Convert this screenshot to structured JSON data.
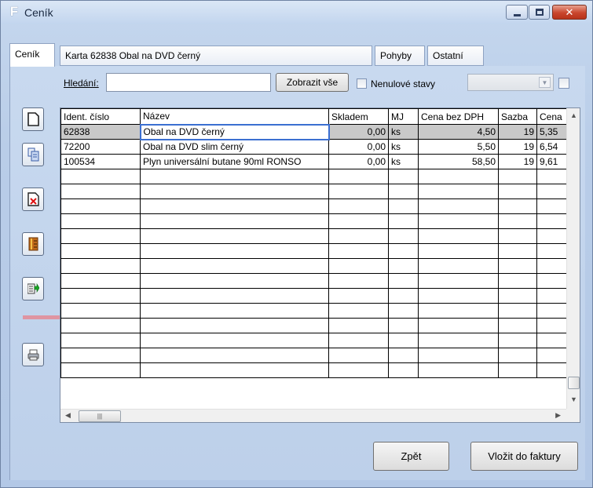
{
  "window": {
    "title": "Ceník"
  },
  "tabs": [
    {
      "label": "Ceník"
    },
    {
      "label": "Karta 62838 Obal na DVD černý"
    },
    {
      "label": "Pohyby"
    },
    {
      "label": "Ostatní"
    }
  ],
  "search": {
    "label": "Hledání:",
    "value": "",
    "show_all_label": "Zobrazit vše"
  },
  "filters": {
    "nonzero_label": "Nenulové stavy",
    "nonzero_checked": false,
    "combo_value": ""
  },
  "toolbar": {
    "buttons": [
      {
        "name": "new-record-button",
        "icon": "new-document-icon"
      },
      {
        "name": "copy-record-button",
        "icon": "copy-icon"
      },
      {
        "name": "delete-record-button",
        "icon": "delete-icon"
      },
      {
        "name": "catalog-button",
        "icon": "book-icon"
      },
      {
        "name": "export-button",
        "icon": "export-green-arrow-icon"
      },
      {
        "name": "print-button",
        "icon": "printer-icon"
      }
    ]
  },
  "grid": {
    "columns": [
      "Ident. číslo",
      "Název",
      "Skladem",
      "MJ",
      "Cena bez DPH",
      "Sazba",
      "Cena"
    ],
    "rows": [
      [
        "62838",
        "Obal na DVD černý",
        "0,00",
        "ks",
        "4,50",
        "19",
        "5,35"
      ],
      [
        "72200",
        "Obal na DVD slim černý",
        "0,00",
        "ks",
        "5,50",
        "19",
        "6,54"
      ],
      [
        "100534",
        "Plyn universální butane 90ml RONSO",
        "0,00",
        "ks",
        "58,50",
        "19",
        "9,61"
      ]
    ],
    "empty_rows": 14,
    "selected_row": 0
  },
  "footer": {
    "back_label": "Zpět",
    "insert_label": "Vložit do faktury"
  },
  "colors": {
    "window_bg": "#bdd0ea",
    "selected_row": "#c9c9c9",
    "focus_border": "#3b6fd1",
    "highlight": "#e8808a"
  }
}
